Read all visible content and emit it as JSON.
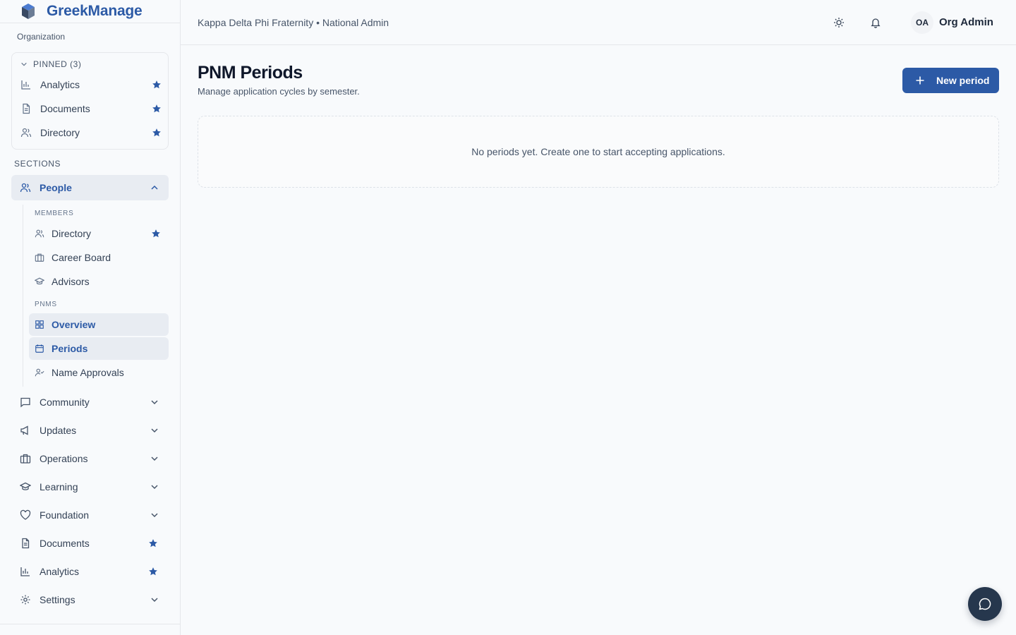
{
  "brand": {
    "name": "GreekManage"
  },
  "sidebar": {
    "org_label": "Organization",
    "pinned": {
      "header": "PINNED (3)",
      "items": [
        {
          "label": "Analytics",
          "icon": "chart-icon"
        },
        {
          "label": "Documents",
          "icon": "document-icon"
        },
        {
          "label": "Directory",
          "icon": "users-icon"
        }
      ]
    },
    "sections_label": "SECTIONS",
    "people": {
      "label": "People",
      "members_label": "MEMBERS",
      "members": [
        {
          "label": "Directory",
          "starred": true
        },
        {
          "label": "Career Board"
        },
        {
          "label": "Advisors"
        }
      ],
      "pnms_label": "PNMS",
      "pnms": [
        {
          "label": "Overview",
          "active": true
        },
        {
          "label": "Periods",
          "active": true
        },
        {
          "label": "Name Approvals"
        }
      ]
    },
    "sections": [
      {
        "label": "Community"
      },
      {
        "label": "Updates"
      },
      {
        "label": "Operations"
      },
      {
        "label": "Learning"
      },
      {
        "label": "Foundation"
      },
      {
        "label": "Documents",
        "starred": true
      },
      {
        "label": "Analytics",
        "starred": true
      },
      {
        "label": "Settings"
      }
    ]
  },
  "topbar": {
    "breadcrumb": "Kappa Delta Phi Fraternity • National Admin",
    "avatar_initials": "OA",
    "user_name": "Org Admin"
  },
  "main": {
    "title": "PNM Periods",
    "subtitle": "Manage application cycles by semester.",
    "new_button_label": "New period",
    "empty_message": "No periods yet. Create one to start accepting applications."
  },
  "colors": {
    "accent": "#2c5aa6",
    "active_bg": "#e8ecf2",
    "fab_bg": "#26374d"
  }
}
